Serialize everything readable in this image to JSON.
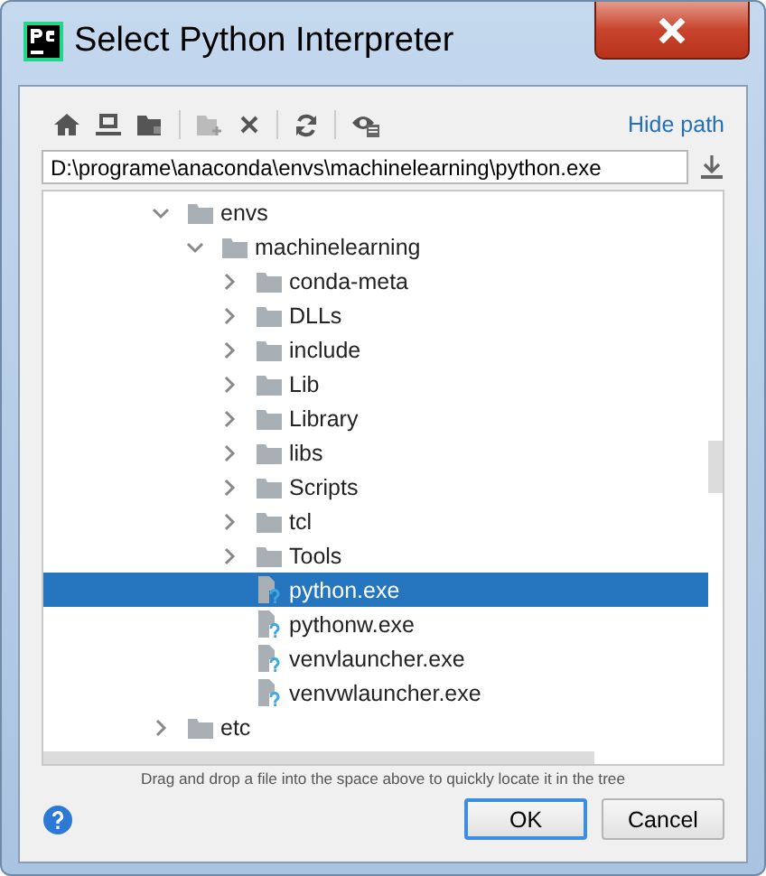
{
  "window": {
    "title": "Select Python Interpreter"
  },
  "toolbar": {
    "hide_path_link": "Hide path"
  },
  "path_field": {
    "value": "D:\\programe\\anaconda\\envs\\machinelearning\\python.exe"
  },
  "tree": [
    {
      "name": "envs",
      "kind": "folder",
      "expanded": true,
      "selected": false,
      "children": [
        {
          "name": "machinelearning",
          "kind": "folder",
          "expanded": true,
          "selected": false,
          "children": [
            {
              "name": "conda-meta",
              "kind": "folder",
              "expanded": false,
              "selected": false
            },
            {
              "name": "DLLs",
              "kind": "folder",
              "expanded": false,
              "selected": false
            },
            {
              "name": "include",
              "kind": "folder",
              "expanded": false,
              "selected": false
            },
            {
              "name": "Lib",
              "kind": "folder",
              "expanded": false,
              "selected": false
            },
            {
              "name": "Library",
              "kind": "folder",
              "expanded": false,
              "selected": false
            },
            {
              "name": "libs",
              "kind": "folder",
              "expanded": false,
              "selected": false
            },
            {
              "name": "Scripts",
              "kind": "folder",
              "expanded": false,
              "selected": false
            },
            {
              "name": "tcl",
              "kind": "folder",
              "expanded": false,
              "selected": false
            },
            {
              "name": "Tools",
              "kind": "folder",
              "expanded": false,
              "selected": false
            },
            {
              "name": "python.exe",
              "kind": "file",
              "selected": true
            },
            {
              "name": "pythonw.exe",
              "kind": "file",
              "selected": false
            },
            {
              "name": "venvlauncher.exe",
              "kind": "file",
              "selected": false
            },
            {
              "name": "venvwlauncher.exe",
              "kind": "file",
              "selected": false
            }
          ]
        }
      ]
    },
    {
      "name": "etc",
      "kind": "folder",
      "expanded": false,
      "selected": false
    }
  ],
  "hint": "Drag and drop a file into the space above to quickly locate it in the tree",
  "buttons": [
    {
      "label": "OK",
      "kind": "default"
    },
    {
      "label": "Cancel",
      "kind": "normal"
    }
  ]
}
